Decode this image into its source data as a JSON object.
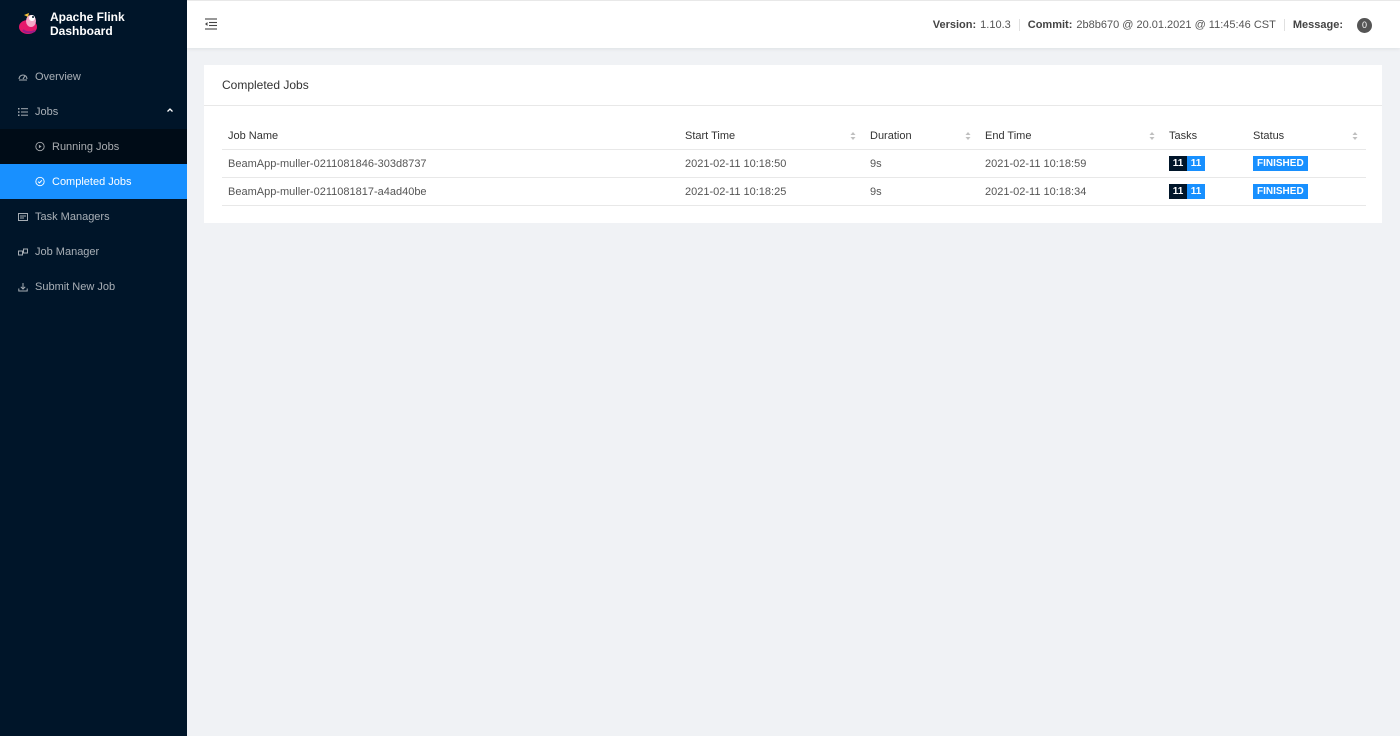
{
  "app": {
    "title": "Apache Flink Dashboard"
  },
  "sidebar": {
    "items": [
      {
        "label": "Overview",
        "icon": "dashboard-icon"
      },
      {
        "label": "Jobs",
        "icon": "list-icon",
        "expanded": true,
        "children": [
          {
            "label": "Running Jobs",
            "icon": "play-circle-icon"
          },
          {
            "label": "Completed Jobs",
            "icon": "check-circle-icon",
            "selected": true
          }
        ]
      },
      {
        "label": "Task Managers",
        "icon": "task-manager-icon"
      },
      {
        "label": "Job Manager",
        "icon": "job-manager-icon"
      },
      {
        "label": "Submit New Job",
        "icon": "upload-icon"
      }
    ]
  },
  "header": {
    "version_label": "Version:",
    "version_value": "1.10.3",
    "commit_label": "Commit:",
    "commit_value": "2b8b670 @ 20.01.2021 @ 11:45:46 CST",
    "message_label": "Message:",
    "message_count": "0"
  },
  "card": {
    "title": "Completed Jobs",
    "columns": [
      "Job Name",
      "Start Time",
      "Duration",
      "End Time",
      "Tasks",
      "Status"
    ],
    "rows": [
      {
        "name": "BeamApp-muller-0211081846-303d8737",
        "start": "2021-02-11 10:18:50",
        "duration": "9s",
        "end": "2021-02-11 10:18:59",
        "tasks_total": "11",
        "tasks_finished": "11",
        "status": "FINISHED"
      },
      {
        "name": "BeamApp-muller-0211081817-a4ad40be",
        "start": "2021-02-11 10:18:25",
        "duration": "9s",
        "end": "2021-02-11 10:18:34",
        "tasks_total": "11",
        "tasks_finished": "11",
        "status": "FINISHED"
      }
    ]
  },
  "colors": {
    "sidebar_bg": "#001529",
    "accent": "#1890ff",
    "content_bg": "#f0f2f5"
  }
}
